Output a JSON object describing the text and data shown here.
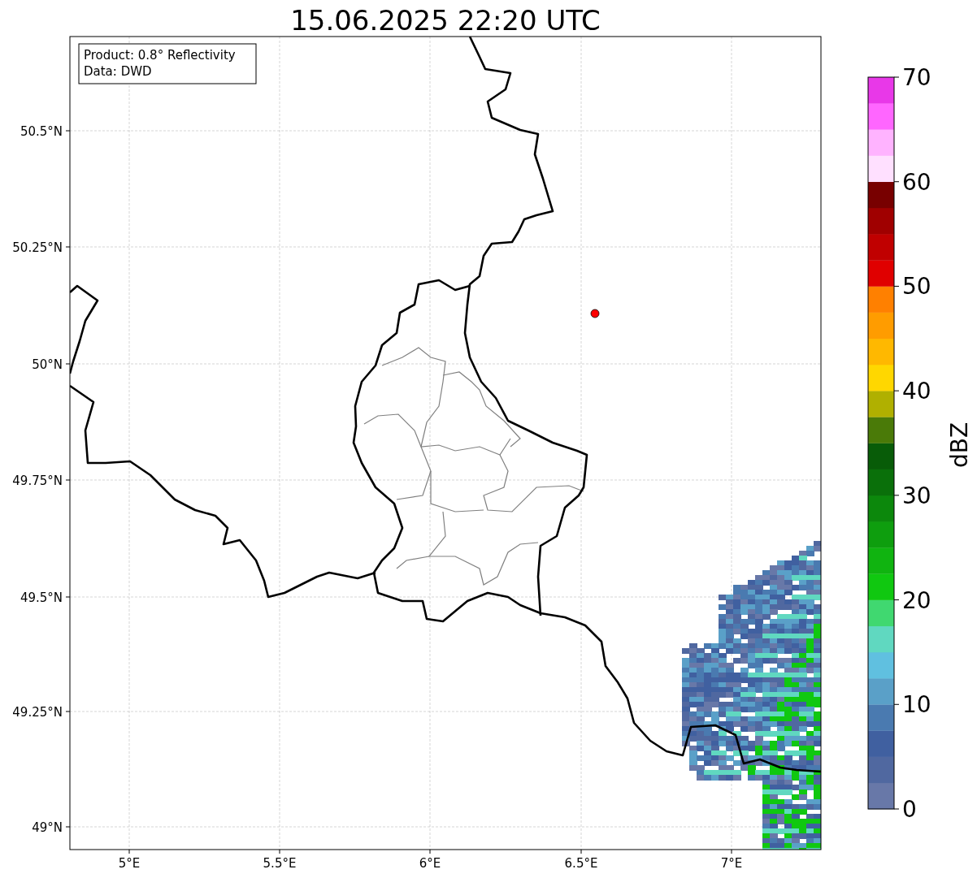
{
  "title": "15.06.2025 22:20 UTC",
  "info_box": {
    "lines": [
      "Product: 0.8° Reflectivity",
      "Data: DWD"
    ]
  },
  "map": {
    "lat_ticks": [
      "50.5°N",
      "50.25°N",
      "50°N",
      "49.75°N",
      "49.5°N",
      "49.25°N",
      "49°N"
    ],
    "lon_ticks": [
      "5°E",
      "5.5°E",
      "6°E",
      "6.5°E",
      "7°E"
    ],
    "marker": {
      "color": "#ff0000"
    }
  },
  "colorbar": {
    "label": "dBZ",
    "ticks": [
      "70",
      "60",
      "50",
      "40",
      "30",
      "20",
      "10",
      "0"
    ],
    "bands": [
      {
        "color": "#6878a8"
      },
      {
        "color": "#5068a0"
      },
      {
        "color": "#4060a0"
      },
      {
        "color": "#4a7ab0"
      },
      {
        "color": "#5aa0c8"
      },
      {
        "color": "#60c0e0"
      },
      {
        "color": "#60d8c0"
      },
      {
        "color": "#40d870"
      },
      {
        "color": "#10c810"
      },
      {
        "color": "#10b410"
      },
      {
        "color": "#0e9e0e"
      },
      {
        "color": "#0c880c"
      },
      {
        "color": "#0a700a"
      },
      {
        "color": "#085c08"
      },
      {
        "color": "#4a7a08"
      },
      {
        "color": "#b0b000"
      },
      {
        "color": "#ffd700"
      },
      {
        "color": "#ffb800"
      },
      {
        "color": "#ff9c00"
      },
      {
        "color": "#ff8000"
      },
      {
        "color": "#e00000"
      },
      {
        "color": "#c00000"
      },
      {
        "color": "#a00000"
      },
      {
        "color": "#780000"
      },
      {
        "color": "#ffe0ff"
      },
      {
        "color": "#ffb3ff"
      },
      {
        "color": "#ff66ff"
      },
      {
        "color": "#e838e8"
      }
    ]
  }
}
